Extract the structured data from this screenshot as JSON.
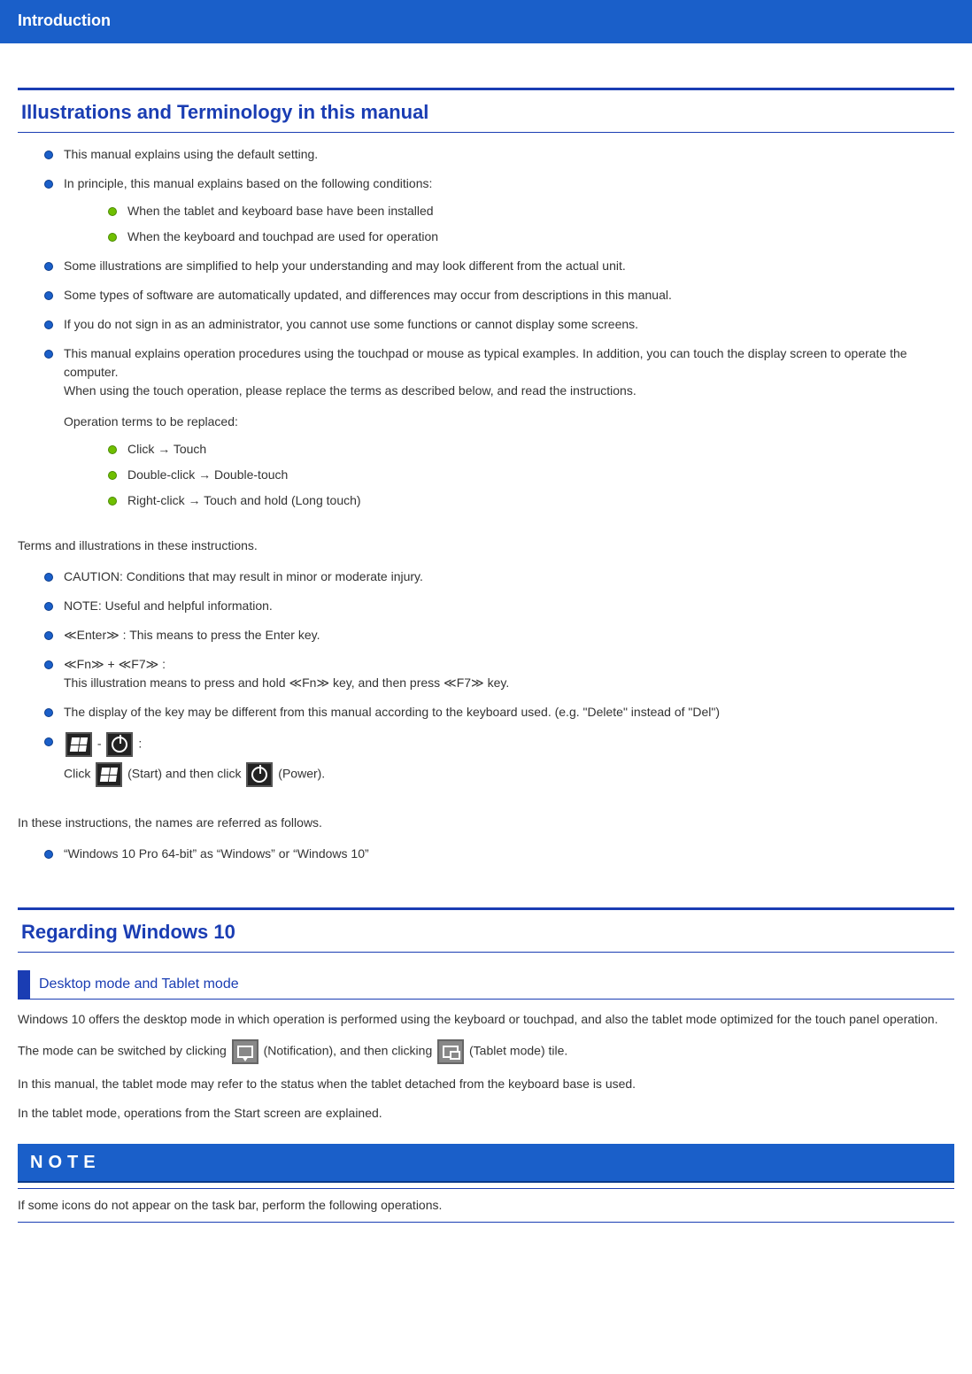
{
  "banner": {
    "title": "Introduction"
  },
  "section1": {
    "title": "Illustrations and Terminology in this manual",
    "items": {
      "i1": "This manual explains using the default setting.",
      "i2": "In principle, this manual explains based on the following conditions:",
      "i2a": "When the tablet and keyboard base have been installed",
      "i2b": "When the keyboard and touchpad are used for operation",
      "i3": "Some illustrations are simplified to help your understanding and may look different from the actual unit.",
      "i4": "Some types of software are automatically updated, and differences may occur from descriptions in this manual.",
      "i5": "If you do not sign in as an administrator, you cannot use some functions or cannot display some screens.",
      "i6a": "This manual explains operation procedures using the touchpad or mouse as typical examples. In addition, you can touch the display screen to operate the computer.",
      "i6b": "When using the touch operation, please replace the terms as described below, and read the instructions.",
      "i6c": "Operation terms to be replaced:",
      "i6c1": "Click → Touch",
      "i6c2": "Double-click → Double-touch",
      "i6c3": "Right-click → Touch and hold (Long touch)"
    },
    "terms_heading": "Terms and illustrations in these instructions.",
    "terms": {
      "t1": "CAUTION: Conditions that may result in minor or moderate injury.",
      "t2": "NOTE: Useful and helpful information.",
      "t3": "≪Enter≫ : This means to press the Enter key.",
      "t4a": "≪Fn≫ + ≪F7≫ :",
      "t4b": "This illustration means to press and hold ≪Fn≫ key, and then press ≪F7≫ key.",
      "t5": "The display of the key may be different from this manual according to the keyboard used. (e.g. \"Delete\" instead of \"Del\")",
      "t6_dash": " - ",
      "t6_colon": " :",
      "t6_click": "Click ",
      "t6_start": " (Start) and then click ",
      "t6_power": " (Power)."
    },
    "names_heading": "In these instructions, the names are referred as follows.",
    "names": {
      "n1": "“Windows 10 Pro 64-bit” as “Windows” or “Windows 10”"
    }
  },
  "section2": {
    "title": "Regarding Windows 10",
    "subhead": "Desktop mode and Tablet mode",
    "p1": "Windows 10 offers the desktop mode in which operation is performed using the keyboard or touchpad, and also the tablet mode optimized for the touch panel operation.",
    "p2a": "The mode can be switched by clicking ",
    "p2b": " (Notification), and then clicking ",
    "p2c": " (Tablet mode) tile.",
    "p3": "In this manual, the tablet mode may refer to the status when the tablet detached from the keyboard base is used.",
    "p4": "In the tablet mode, operations from the Start screen are explained."
  },
  "note": {
    "label": "NOTE",
    "text": "If some icons do not appear on the task bar, perform the following operations."
  }
}
